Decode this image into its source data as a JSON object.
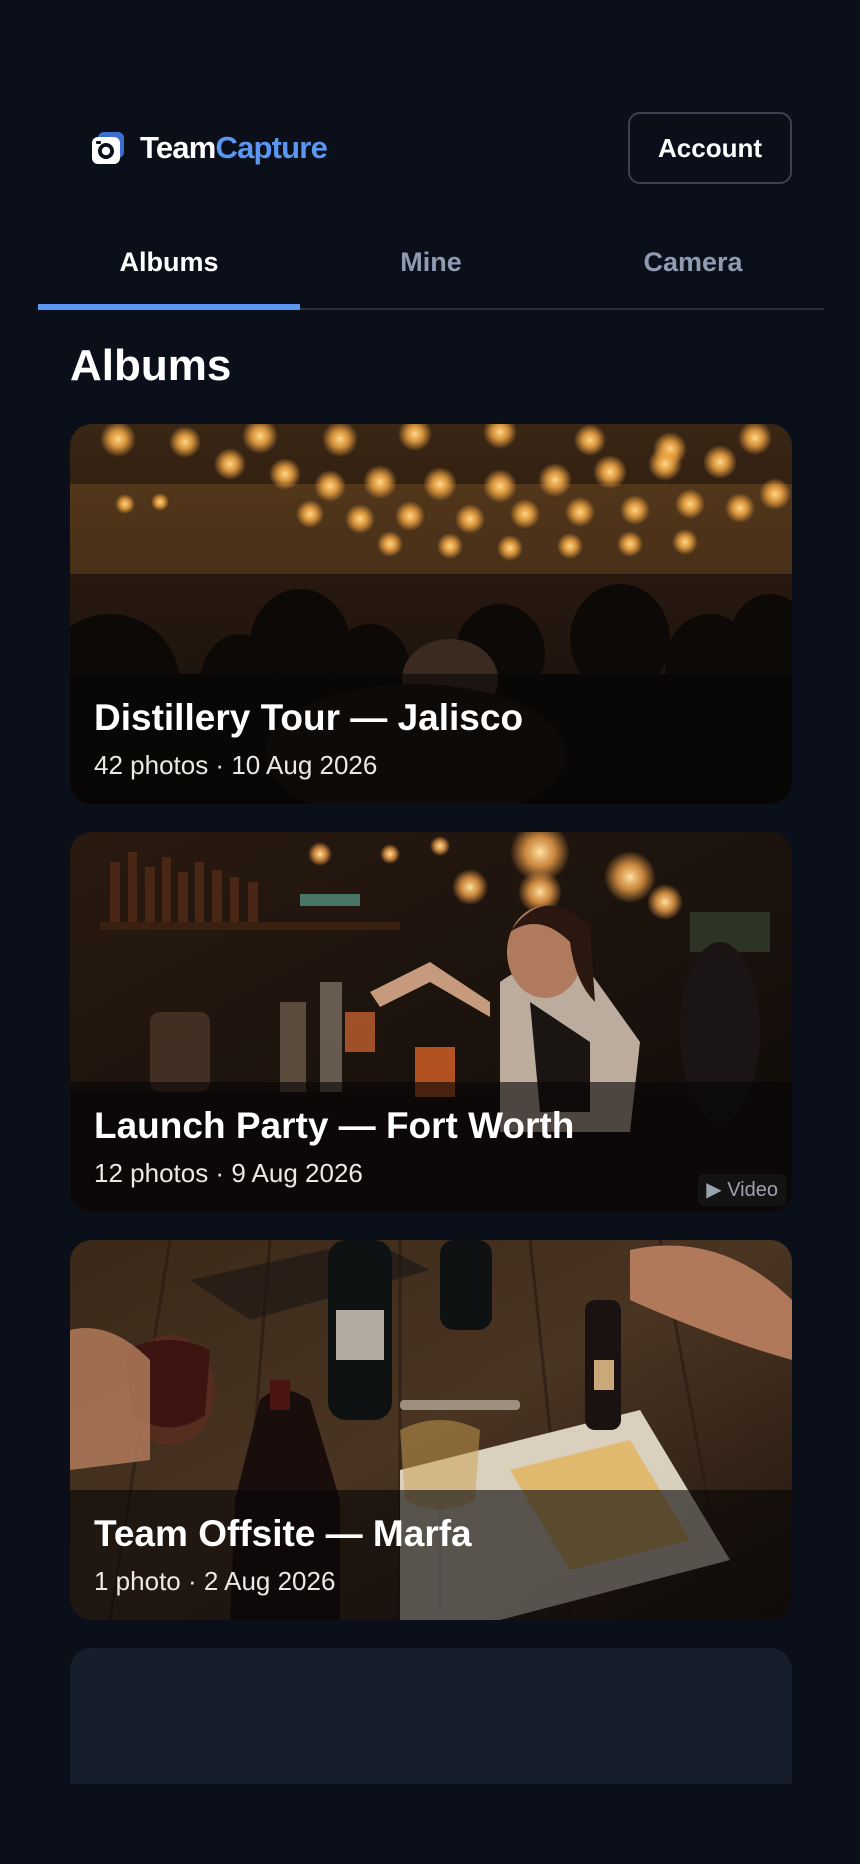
{
  "header": {
    "brand_part1": "Team",
    "brand_part2": "Capture",
    "account_label": "Account",
    "logo_icon": "camera-icon"
  },
  "tabs": [
    {
      "label": "Albums",
      "active": true
    },
    {
      "label": "Mine",
      "active": false
    },
    {
      "label": "Camera",
      "active": false
    }
  ],
  "section": {
    "title": "Albums"
  },
  "albums": [
    {
      "title": "Distillery Tour — Jalisco",
      "meta": "42 photos · 10 Aug 2026"
    },
    {
      "title": "Launch Party — Fort Worth",
      "meta": "12 photos · 9 Aug 2026",
      "badge": "▶ Video"
    },
    {
      "title": "Team Offsite — Marfa",
      "meta": "1 photo · 2 Aug 2026"
    }
  ],
  "colors": {
    "background": "#0a0f1a",
    "accent": "#5b96f0",
    "tab_inactive": "#8e9bb3",
    "card_placeholder": "#161d2b"
  }
}
